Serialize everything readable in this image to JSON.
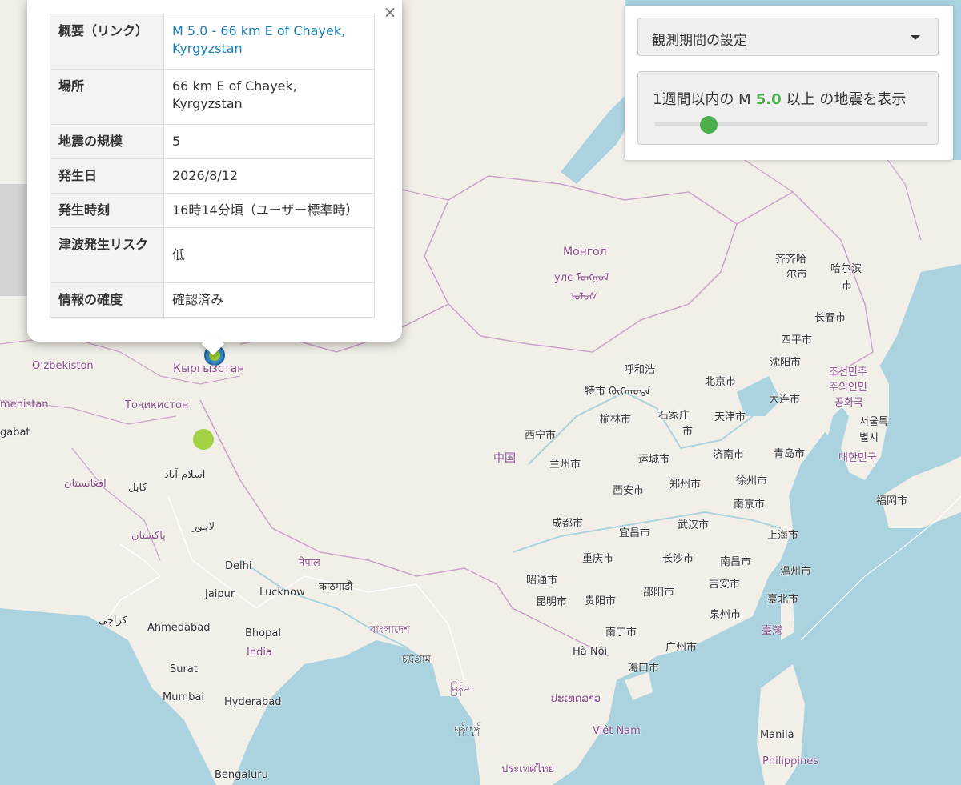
{
  "map": {
    "labels": {
      "mongolia": "Монгол",
      "mongolia_2": "улс ᠮᠣᠩᠭᠣᠯ",
      "mongolia_3": "ᠤᠯᠤᠰ",
      "china": "中国",
      "kyrgyzstan": "Кыргызстан",
      "uzbekistan": "Oʻzbekiston",
      "tajikistan": "Тоҷикистон",
      "turkmenistan": "menistan",
      "ashgabat": "gabat",
      "afghanistan": "افغانستان",
      "kabul": "کابل",
      "islamabad": "اسلام آباد",
      "pakistan": "پاکستان",
      "lahore": "لاہور",
      "nepal": "नेपाल",
      "kathmandu": "काठमाडौं",
      "delhi": "Delhi",
      "jaipur": "Jaipur",
      "lucknow": "Lucknow",
      "karachi": "کراچی",
      "ahmedabad": "Ahmedabad",
      "bhopal": "Bhopal",
      "india": "India",
      "surat": "Surat",
      "mumbai": "Mumbai",
      "hyderabad": "Hyderabad",
      "bengaluru": "Bengaluru",
      "bangladesh": "বাংলাদেশ",
      "chattogram": "চট্টগ্রাম",
      "myanmar": "မြန်မာ",
      "yangon": "ရန်ကုန်",
      "thailand": "ประเทศไทย",
      "laos": "ປະເທດລາວ",
      "vietnam": "Việt Nam",
      "hanoi": "Hà Nội",
      "manila": "Manila",
      "philippines": "Philippines",
      "hohhot": "呼和浩",
      "hohhot_2": "特市 ᠬᠥᠬᠡᠬᠣᠲᠠ",
      "beijing": "北京市",
      "shijiazhuang": "石家庄",
      "shijiazhuang_2": "市",
      "tianjin": "天津市",
      "yulin": "榆林市",
      "xining": "西宁市",
      "lanzhou": "兰州市",
      "yuncheng": "运城市",
      "jinan": "济南市",
      "qingdao": "青岛市",
      "xian": "西安市",
      "zhengzhou": "郑州市",
      "xuzhou": "徐州市",
      "nanjing": "南京市",
      "chengdu": "成都市",
      "yichang": "宜昌市",
      "wuhan": "武汉市",
      "shanghai": "上海市",
      "chongqing": "重庆市",
      "changsha": "长沙市",
      "nanchang": "南昌市",
      "wenzhou": "温州市",
      "zhaotong": "昭通市",
      "kunming": "昆明市",
      "guiyang": "贵阳市",
      "shaoyang": "邵阳市",
      "jian": "吉安市",
      "taipei": "臺北市",
      "taiwan": "臺灣",
      "quanzhou": "泉州市",
      "nanning": "南宁市",
      "guangzhou": "广州市",
      "haikou": "海口市",
      "qiqihar": "齐齐哈",
      "qiqihar_2": "尔市",
      "harbin": "哈尔滨",
      "harbin_2": "市",
      "changchun": "长春市",
      "siping": "四平市",
      "shenyang": "沈阳市",
      "dalian": "大连市",
      "north_korea": "조선민주",
      "north_korea_2": "주의인민",
      "north_korea_3": "공화국",
      "seoul": "서울특",
      "seoul_2": "별시",
      "south_korea": "대한민국",
      "fukuoka": "福岡市"
    }
  },
  "popup": {
    "close_symbol": "×",
    "rows": [
      {
        "label": "概要（リンク）",
        "value": "M 5.0 - 66 km E of Chayek, Kyrgyzstan"
      },
      {
        "label": "場所",
        "value": "66 km E of Chayek, Kyrgyzstan"
      },
      {
        "label": "地震の規模",
        "value": "5"
      },
      {
        "label": "発生日",
        "value": "2026/8/12"
      },
      {
        "label": "発生時刻",
        "value": "16時14分頃（ユーザー標準時）"
      },
      {
        "label": "津波発生リスク",
        "value": "低"
      },
      {
        "label": "情報の確度",
        "value": "確認済み"
      }
    ]
  },
  "panel": {
    "period_label": "観測期間の設定",
    "filter_prefix": "1週間以内の M",
    "magnitude": "5.0",
    "filter_suffix": "以上 の地震を表示",
    "slider_fraction": 0.2
  },
  "colors": {
    "water": "#aad3df",
    "land": "#f2efe9",
    "marker_blue": "#3388cc",
    "marker_green": "#9acd32",
    "accent_green": "#4cae4c",
    "link": "#1a7fb5"
  }
}
